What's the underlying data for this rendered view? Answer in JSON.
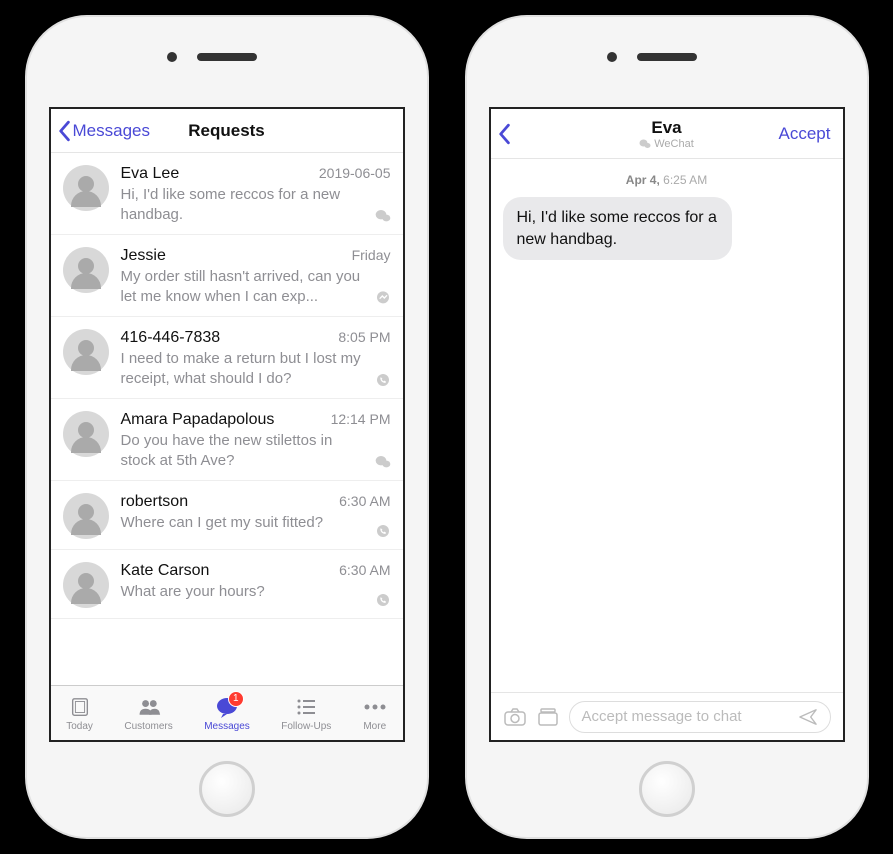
{
  "left": {
    "back_label": "Messages",
    "title": "Requests",
    "rows": [
      {
        "name": "Eva Lee",
        "time": "2019-06-05",
        "preview": "Hi, I'd like some reccos for a new handbag.",
        "channel": "wechat"
      },
      {
        "name": "Jessie",
        "time": "Friday",
        "preview": "My order still hasn't arrived, can you let me know when I can exp...",
        "channel": "messenger"
      },
      {
        "name": "416-446-7838",
        "time": "8:05 PM",
        "preview": "I need to make a return but I lost my receipt, what should I do?",
        "channel": "whatsapp"
      },
      {
        "name": "Amara Papadapolous",
        "time": "12:14 PM",
        "preview": "Do you have the new stilettos in stock at 5th Ave?",
        "channel": "wechat"
      },
      {
        "name": "robertson",
        "time": "6:30 AM",
        "preview": "Where can I get my suit fitted?",
        "channel": "whatsapp"
      },
      {
        "name": "Kate Carson",
        "time": "6:30 AM",
        "preview": "What are your hours?",
        "channel": "whatsapp"
      }
    ],
    "tabs": [
      {
        "label": "Today"
      },
      {
        "label": "Customers"
      },
      {
        "label": "Messages",
        "badge": "1"
      },
      {
        "label": "Follow-Ups"
      },
      {
        "label": "More"
      }
    ]
  },
  "right": {
    "title": "Eva",
    "subtitle": "WeChat",
    "accept_label": "Accept",
    "timestamp_day": "Apr 4,",
    "timestamp_time": "6:25 AM",
    "bubble_text": "Hi, I'd like some reccos for a new handbag.",
    "composer_placeholder": "Accept message to chat"
  }
}
